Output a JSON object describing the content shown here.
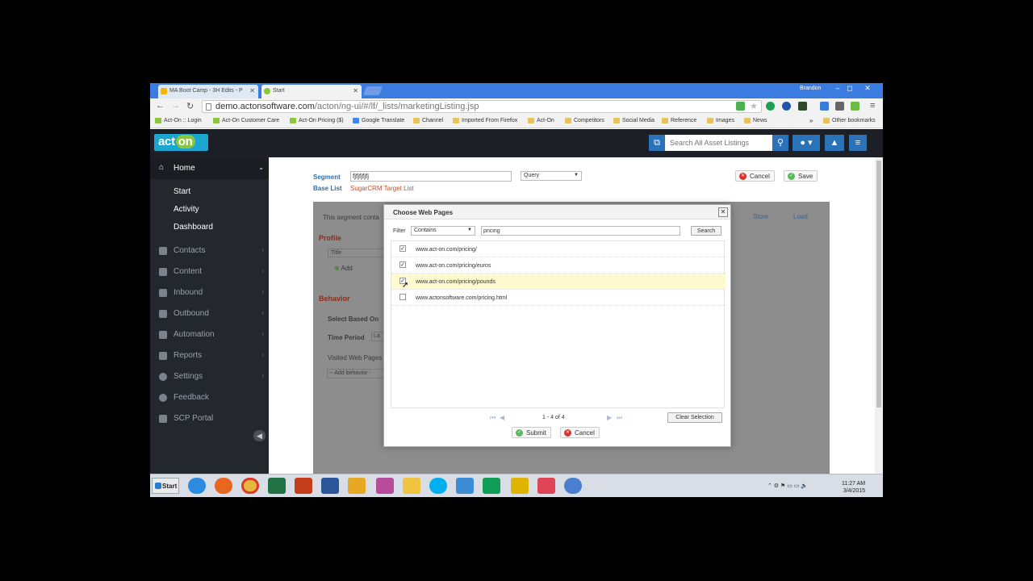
{
  "browser": {
    "tabs": [
      {
        "label": "MA Boot Camp - 3H Edits - P",
        "active": false
      },
      {
        "label": "Start",
        "active": true
      }
    ],
    "user": "Brandon",
    "url_host": "demo.actonsoftware.com",
    "url_path": "/acton/ng-ui/#/lf/_lists/marketingListing.jsp",
    "bookmarks": [
      "Act-On :: Login",
      "Act-On Customer Care",
      "Act-On Pricing ($)",
      "Google Translate",
      "Channel",
      "Imported From Firefox",
      "Act-On",
      "Competitors",
      "Social Media",
      "Reference",
      "Images",
      "News"
    ],
    "more_bookmarks": "»",
    "other_bookmarks": "Other bookmarks"
  },
  "header": {
    "logo_a": "act",
    "logo_b": "on",
    "search_placeholder": "Search All Asset Listings"
  },
  "sidebar": {
    "home": "Home",
    "sub_items": [
      "Start",
      "Activity",
      "Dashboard"
    ],
    "items": [
      "Contacts",
      "Content",
      "Inbound",
      "Outbound",
      "Automation",
      "Reports",
      "Settings",
      "Feedback",
      "SCP Portal"
    ]
  },
  "form": {
    "segment_label": "Segment",
    "segment_value": "fjfjfjfjfj",
    "query_select": "Query",
    "base_list_label": "Base List",
    "base_list_value": "SugarCRM Target List",
    "cancel": "Cancel",
    "save": "Save"
  },
  "background": {
    "segment_note": "This segment conta",
    "store": "Store",
    "load": "Load",
    "profile": "Profile",
    "title_col": "Title",
    "add": "Add",
    "behavior": "Behavior",
    "select_based_on": "Select Based On",
    "time_period": "Time Period",
    "time_period_value": "La",
    "visited_pages": "Visited Web Pages",
    "add_behavior": "-- Add behavior -"
  },
  "modal": {
    "title": "Choose Web Pages",
    "filter_label": "Filter",
    "filter_mode": "Contains",
    "filter_value": "pricing",
    "search_btn": "Search",
    "rows": [
      {
        "url": "www.act-on.com/pricing/",
        "checked": true
      },
      {
        "url": "www.act-on.com/pricing/euros",
        "checked": true
      },
      {
        "url": "www.act-on.com/pricing/pounds",
        "checked": true
      },
      {
        "url": "www.actonsoftware.com/pricing.html",
        "checked": false
      }
    ],
    "pager": "1 - 4 of 4",
    "clear_btn": "Clear Selection",
    "submit": "Submit",
    "cancel": "Cancel"
  },
  "taskbar": {
    "start": "Start",
    "time": "11:27 AM",
    "date": "3/4/2015"
  },
  "colors": {
    "accent": "#2a73b8",
    "logo": "#1aa6d0",
    "logo_on": "#8cc63f",
    "highlight_row": "#fdfacf",
    "sidebar": "#25272f"
  }
}
